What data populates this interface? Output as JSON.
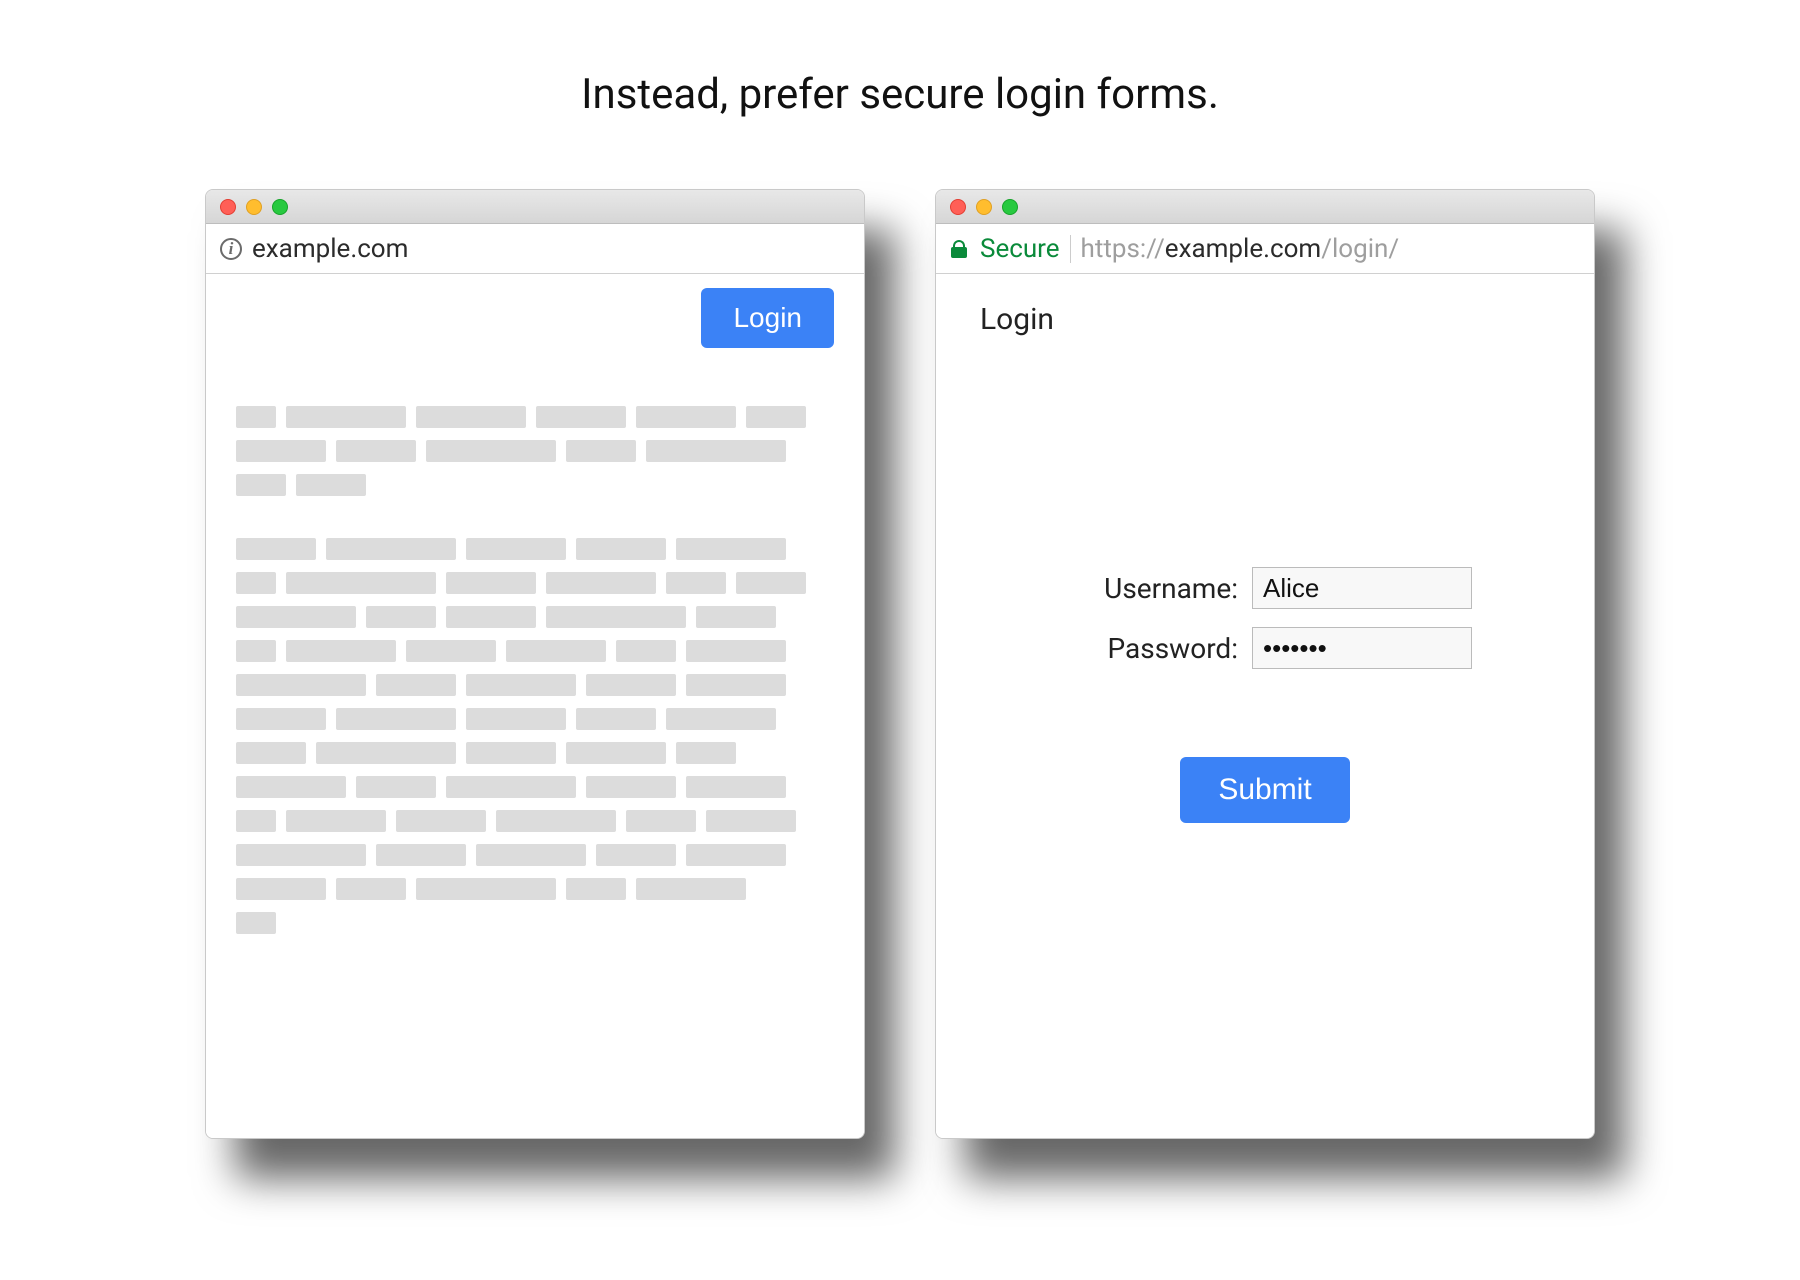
{
  "heading": "Instead, prefer secure login forms.",
  "left": {
    "url": "example.com",
    "login_button": "Login"
  },
  "right": {
    "secure_label": "Secure",
    "url_scheme": "https://",
    "url_host": "example.com",
    "url_path": "/login/",
    "page_title": "Login",
    "username_label": "Username:",
    "username_value": "Alice",
    "password_label": "Password:",
    "password_value": "•••••••",
    "submit_label": "Submit"
  }
}
